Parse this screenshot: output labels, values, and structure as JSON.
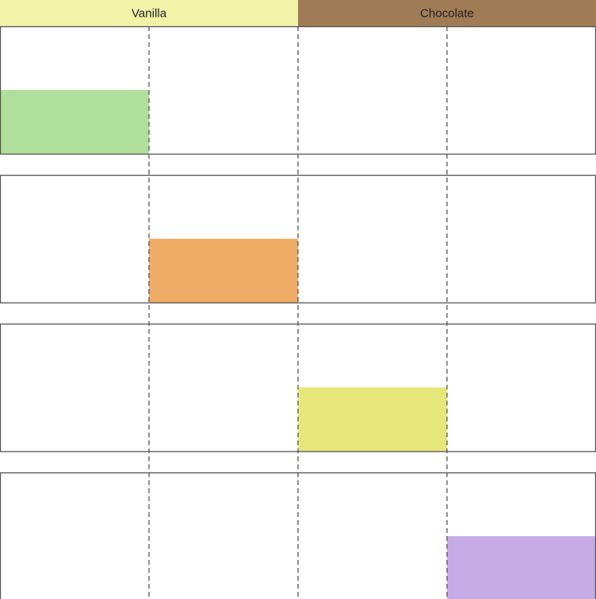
{
  "chart_data": {
    "type": "bar",
    "header_columns": [
      {
        "label": "Vanilla",
        "color": "#f2f2a9"
      },
      {
        "label": "Chocolate",
        "color": "#a07c56"
      }
    ],
    "sub_columns_per_header": 2,
    "rows": [
      {
        "column": 0,
        "level": 0.5,
        "color": "#b0de9b"
      },
      {
        "column": 1,
        "level": 0.5,
        "color": "#eeac66"
      },
      {
        "column": 2,
        "level": 0.5,
        "color": "#e7e779"
      },
      {
        "column": 3,
        "level": 0.5,
        "color": "#c6aae6"
      }
    ],
    "colors": {
      "background": "#ffffff",
      "panel_border": "#555555",
      "dashed_lines": "#555555",
      "header_text": "#222222"
    }
  }
}
